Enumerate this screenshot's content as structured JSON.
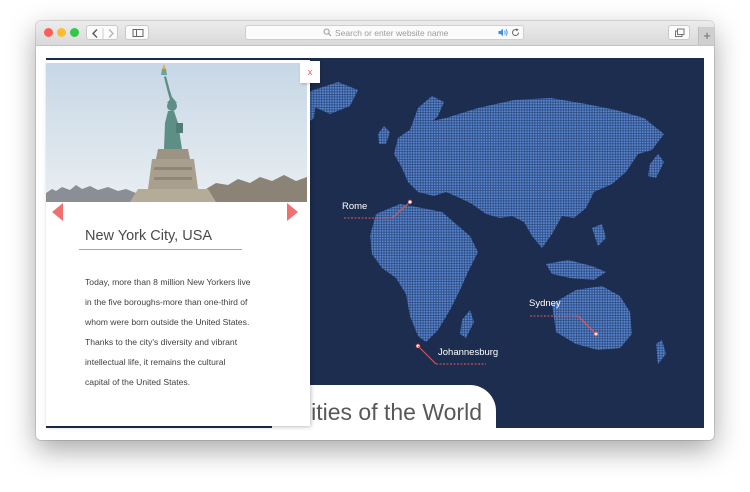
{
  "browser": {
    "address_placeholder": "Search or enter website name",
    "new_tab_label": "+",
    "icons": [
      "back-icon",
      "forward-icon",
      "sidebar-icon",
      "search-icon",
      "audio-icon",
      "reload-icon",
      "tabs-overview-icon"
    ]
  },
  "map": {
    "colors": {
      "ocean": "#1c2d4f",
      "land": "#4a75bd",
      "marker": "#e05a5a"
    },
    "cities": [
      {
        "name": "Rome"
      },
      {
        "name": "Sydney"
      },
      {
        "name": "Johannesburg"
      }
    ]
  },
  "page": {
    "title": "Cities of the World"
  },
  "panel": {
    "close_label": "x",
    "city_title": "New York City, USA",
    "description_lines": [
      "Today, more than 8 million New Yorkers live",
      "in the five boroughs-more than one-third of",
      "whom were born outside the United States.",
      "Thanks to the city's diversity and vibrant",
      "intellectual life, it remains the cultural",
      "capital of the United States."
    ]
  }
}
